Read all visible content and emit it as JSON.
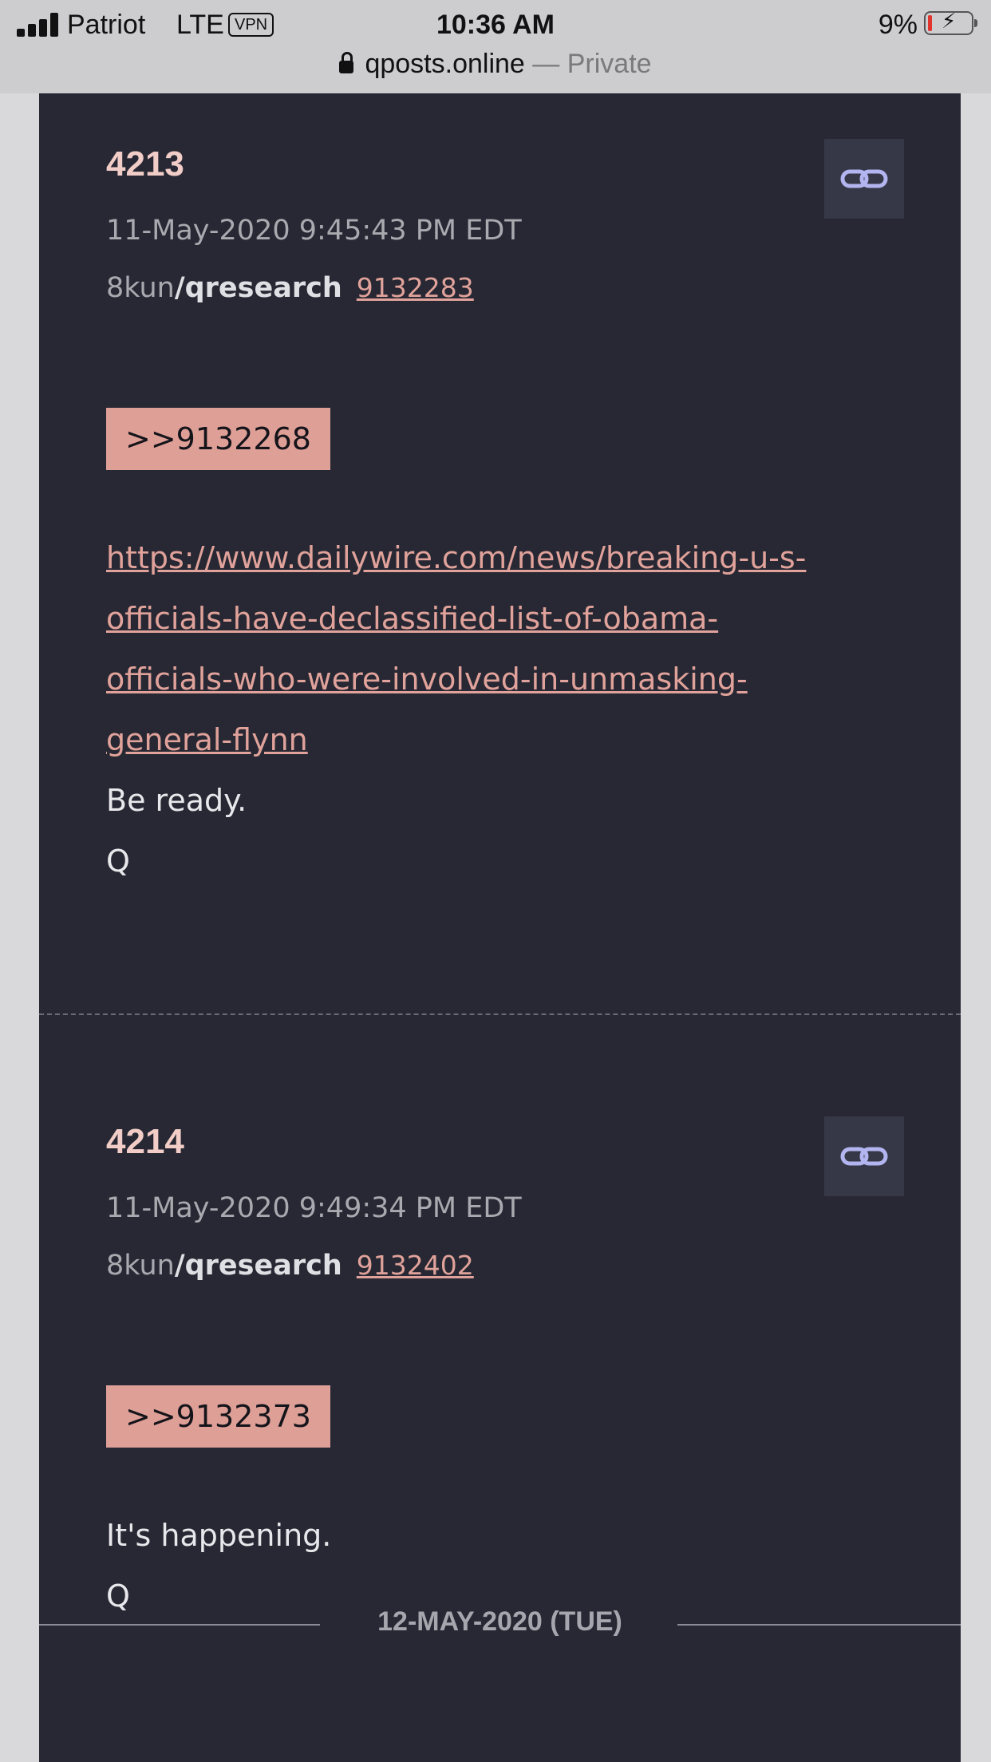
{
  "status_bar": {
    "carrier": "Patriot",
    "network": "LTE",
    "vpn": "VPN",
    "time": "10:36 AM",
    "battery": "9%"
  },
  "browser": {
    "host": "qposts.online",
    "mode": "— Private"
  },
  "posts": [
    {
      "number": "4213",
      "datetime": "11-May-2020 9:45:43 PM EDT",
      "site": "8kun",
      "board": "/qresearch",
      "post_id": "9132283",
      "reply_to": ">>9132268",
      "link_lines": [
        "https://www.dailywire.com/news/breaking-u-s-",
        "officials-have-declassified-list-of-obama-",
        "officials-who-were-involved-in-unmasking-",
        "general-flynn"
      ],
      "lines": [
        "Be ready.",
        "Q"
      ]
    },
    {
      "number": "4214",
      "datetime": "11-May-2020 9:49:34 PM EDT",
      "site": "8kun",
      "board": "/qresearch",
      "post_id": "9132402",
      "reply_to": ">>9132373",
      "lines": [
        "It's happening.",
        "Q"
      ]
    }
  ],
  "date_separator": "12-MAY-2020 (TUE)",
  "icons": {
    "post_link": "chain-link-icon",
    "lock": "lock-icon"
  },
  "colors": {
    "panel_bg": "#272833",
    "accent_pink": "#de9f97",
    "link": "#e0a29a"
  }
}
